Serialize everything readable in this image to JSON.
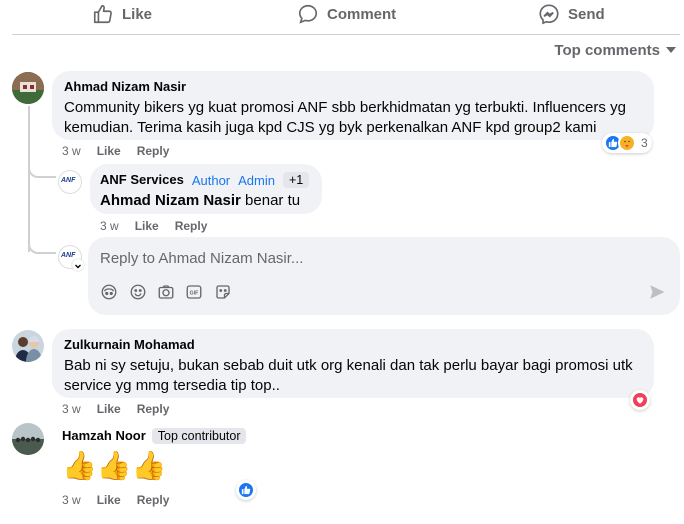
{
  "actions": {
    "like_label": "Like",
    "comment_label": "Comment",
    "send_label": "Send"
  },
  "sort": {
    "label": "Top comments"
  },
  "comments": [
    {
      "author": "Ahmad Nizam Nasir",
      "text_line1": "Community bikers yg kuat promosi ANF sbb berkhidmatan yg terbukti. Influencers yg",
      "text_line2": "kemudian. Terima kasih juga kpd CJS yg byk perkenalkan ANF kpd group2 kami",
      "time": "3 w",
      "like": "Like",
      "reply": "Reply",
      "reaction_count": "3"
    },
    {
      "author": "Zulkurnain Mohamad",
      "text_line1": "Bab ni sy setuju, bukan sebab duit utk org kenali dan tak perlu bayar bagi promosi utk",
      "text_line2": "service yg mmg tersedia tip top..",
      "time": "3 w",
      "like": "Like",
      "reply": "Reply"
    },
    {
      "author": "Hamzah Noor",
      "badge": "Top contributor",
      "text": "👍👍👍",
      "time": "3 w",
      "like": "Like",
      "reply": "Reply"
    }
  ],
  "reply": {
    "author": "ANF Services",
    "author_tag": "Author",
    "admin_tag": "Admin",
    "extra_badge": "+1",
    "mention": "Ahmad Nizam Nasir",
    "text": "benar tu",
    "time": "3 w",
    "like": "Like",
    "reply": "Reply",
    "avatar_text": "ANF"
  },
  "composer": {
    "placeholder": "Reply to Ahmad Nizam Nasir..."
  },
  "colors": {
    "accent": "#1877f2",
    "bubble": "#f0f2f5",
    "secondary_text": "#65676b",
    "love": "#f33e58"
  }
}
